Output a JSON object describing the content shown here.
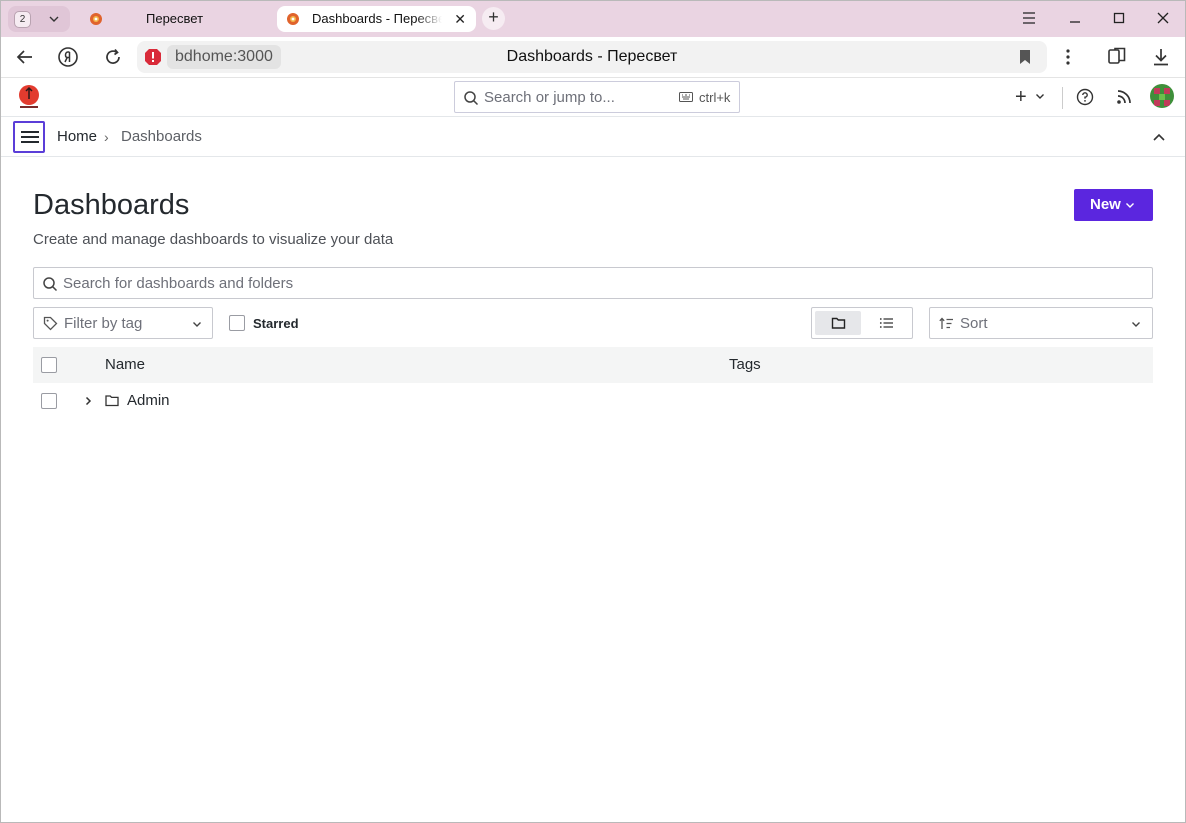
{
  "browser": {
    "tab_count": "2",
    "tabs": [
      {
        "title": "Пересвет"
      },
      {
        "title": "Dashboards - Пересвет"
      }
    ],
    "url_host": "bdhome:3000",
    "page_title": "Dashboards - Пересвет"
  },
  "topbar": {
    "search_placeholder": "Search or jump to...",
    "search_shortcut": "ctrl+k"
  },
  "breadcrumb": {
    "home": "Home",
    "separator": "›",
    "current": "Dashboards"
  },
  "page": {
    "title": "Dashboards",
    "subtitle": "Create and manage dashboards to visualize your data",
    "new_button": "New"
  },
  "filters": {
    "search_placeholder": "Search for dashboards and folders",
    "tag_placeholder": "Filter by tag",
    "starred_label": "Starred",
    "sort_placeholder": "Sort",
    "view_mode": "folders"
  },
  "table": {
    "headers": {
      "name": "Name",
      "tags": "Tags"
    },
    "rows": [
      {
        "name": "Admin",
        "type": "folder"
      }
    ]
  },
  "colors": {
    "primary": "#5b26df",
    "focus_outline": "#5b3ed8",
    "tab_strip": "#ead4e2"
  }
}
